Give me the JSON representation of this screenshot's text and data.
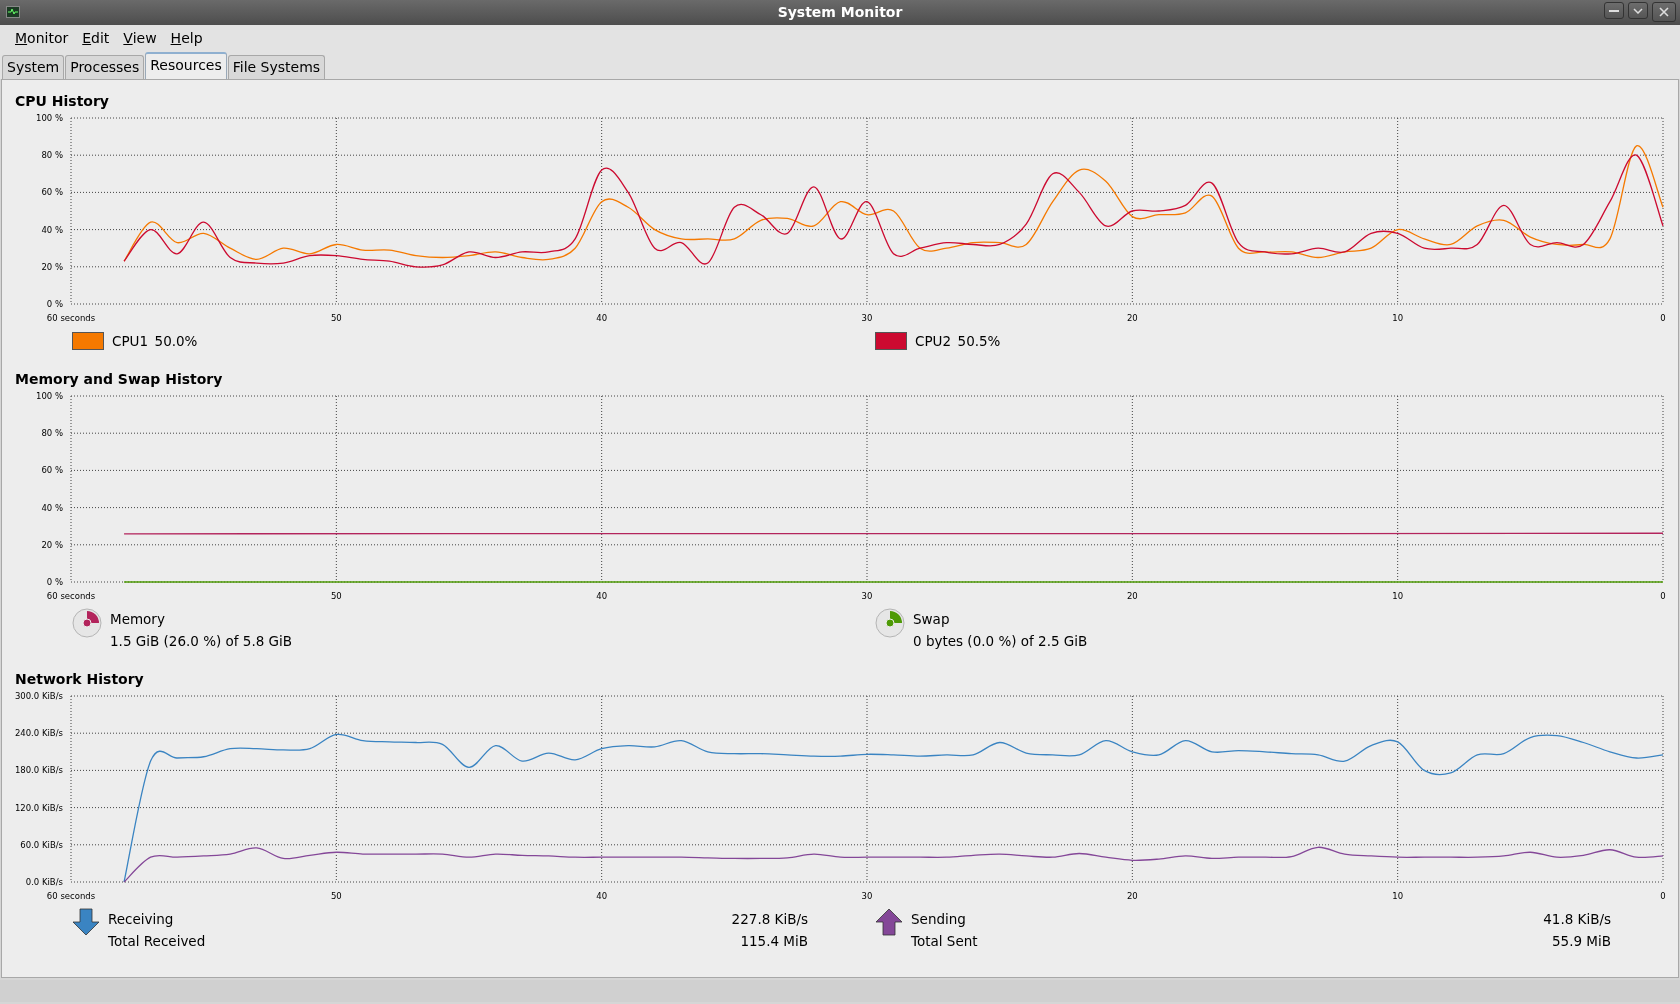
{
  "window": {
    "title": "System Monitor"
  },
  "menu": [
    {
      "label": "Monitor"
    },
    {
      "label": "Edit"
    },
    {
      "label": "View"
    },
    {
      "label": "Help"
    }
  ],
  "tabs": [
    {
      "label": "System",
      "selected": false
    },
    {
      "label": "Processes",
      "selected": false
    },
    {
      "label": "Resources",
      "selected": true
    },
    {
      "label": "File Systems",
      "selected": false
    }
  ],
  "sections": [
    {
      "kind": "cpu",
      "title": "CPU History",
      "chart_data": {
        "type": "line",
        "grid": true,
        "x": [
          58,
          57,
          56,
          55,
          54,
          53,
          52,
          51,
          50,
          49,
          48,
          47,
          46,
          45,
          44,
          43,
          42,
          41,
          40,
          39,
          38,
          37,
          36,
          35,
          34,
          33,
          32,
          31,
          30,
          29,
          28,
          27,
          26,
          25,
          24,
          23,
          22,
          21,
          20,
          19,
          18,
          17,
          16,
          15,
          14,
          13,
          12,
          11,
          10,
          9,
          8,
          7,
          6,
          5,
          4,
          3,
          2,
          1,
          0
        ],
        "xlim": [
          60,
          0
        ],
        "ylim": [
          0,
          100
        ],
        "xticks": [
          {
            "value": 60,
            "label": "60 seconds"
          },
          {
            "value": 50,
            "label": "50"
          },
          {
            "value": 40,
            "label": "40"
          },
          {
            "value": 30,
            "label": "30"
          },
          {
            "value": 20,
            "label": "20"
          },
          {
            "value": 10,
            "label": "10"
          },
          {
            "value": 0,
            "label": "0"
          }
        ],
        "yticks": [
          {
            "value": 0,
            "label": "0 %"
          },
          {
            "value": 20,
            "label": "20 %"
          },
          {
            "value": 40,
            "label": "40 %"
          },
          {
            "value": 60,
            "label": "60 %"
          },
          {
            "value": 80,
            "label": "80 %"
          },
          {
            "value": 100,
            "label": "100 %"
          }
        ],
        "series": [
          {
            "name": "CPU1",
            "color": "#f57900",
            "values": [
              23,
              44,
              33,
              38,
              30,
              24,
              30,
              27,
              32,
              29,
              29,
              26,
              25,
              26,
              28,
              25,
              24,
              30,
              55,
              52,
              40,
              35,
              35,
              35,
              45,
              46,
              42,
              55,
              48,
              50,
              30,
              30,
              33,
              33,
              32,
              55,
              72,
              66,
              47,
              48,
              49,
              58,
              30,
              28,
              28,
              25,
              28,
              30,
              40,
              35,
              32,
              42,
              45,
              36,
              32,
              32,
              35,
              85,
              52
            ]
          },
          {
            "name": "CPU2",
            "color": "#cc0a30",
            "values": [
              23,
              40,
              27,
              44,
              25,
              22,
              22,
              26,
              26,
              24,
              23,
              20,
              21,
              28,
              25,
              28,
              28,
              35,
              72,
              60,
              30,
              33,
              22,
              52,
              48,
              38,
              63,
              35,
              55,
              27,
              30,
              33,
              32,
              32,
              43,
              70,
              60,
              42,
              50,
              50,
              53,
              65,
              33,
              28,
              27,
              30,
              28,
              38,
              38,
              30,
              30,
              32,
              53,
              32,
              33,
              32,
              55,
              80,
              42
            ]
          }
        ]
      },
      "legend": [
        {
          "value": "50.0%"
        },
        {
          "value": "50.5%"
        }
      ]
    },
    {
      "kind": "memory",
      "title": "Memory and Swap History",
      "chart_data": {
        "type": "line",
        "grid": true,
        "x": [
          58,
          40,
          20,
          0
        ],
        "xlim": [
          60,
          0
        ],
        "ylim": [
          0,
          100
        ],
        "xticks": [
          {
            "value": 60,
            "label": "60 seconds"
          },
          {
            "value": 50,
            "label": "50"
          },
          {
            "value": 40,
            "label": "40"
          },
          {
            "value": 30,
            "label": "30"
          },
          {
            "value": 20,
            "label": "20"
          },
          {
            "value": 10,
            "label": "10"
          },
          {
            "value": 0,
            "label": "0"
          }
        ],
        "yticks": [
          {
            "value": 0,
            "label": "0 %"
          },
          {
            "value": 20,
            "label": "20 %"
          },
          {
            "value": 40,
            "label": "40 %"
          },
          {
            "value": 60,
            "label": "60 %"
          },
          {
            "value": 80,
            "label": "80 %"
          },
          {
            "value": 100,
            "label": "100 %"
          }
        ],
        "series": [
          {
            "name": "Memory",
            "color": "#b3245c",
            "values": [
              25.9,
              26,
              26,
              26.2
            ]
          },
          {
            "name": "Swap",
            "color": "#4e9a06",
            "values": [
              0,
              0,
              0,
              0
            ]
          }
        ]
      },
      "legend": [
        {
          "value": "1.5 GiB (26.0 %) of 5.8 GiB"
        },
        {
          "value": "0 bytes (0.0 %) of 2.5 GiB"
        }
      ]
    },
    {
      "kind": "network",
      "title": "Network History",
      "chart_data": {
        "type": "line",
        "grid": true,
        "x": [
          58,
          57,
          56,
          55,
          54,
          53,
          52,
          51,
          50,
          49,
          48,
          47,
          46,
          45,
          44,
          43,
          42,
          41,
          40,
          39,
          38,
          37,
          36,
          35,
          34,
          33,
          32,
          31,
          30,
          29,
          28,
          27,
          26,
          25,
          24,
          23,
          22,
          21,
          20,
          19,
          18,
          17,
          16,
          15,
          14,
          13,
          12,
          11,
          10,
          9,
          8,
          7,
          6,
          5,
          4,
          3,
          2,
          1,
          0
        ],
        "xlim": [
          60,
          0
        ],
        "ylim": [
          0,
          300
        ],
        "xticks": [
          {
            "value": 60,
            "label": "60 seconds"
          },
          {
            "value": 50,
            "label": "50"
          },
          {
            "value": 40,
            "label": "40"
          },
          {
            "value": 30,
            "label": "30"
          },
          {
            "value": 20,
            "label": "20"
          },
          {
            "value": 10,
            "label": "10"
          },
          {
            "value": 0,
            "label": "0"
          }
        ],
        "yticks": [
          {
            "value": 0,
            "label": "0.0 KiB/s"
          },
          {
            "value": 60,
            "label": "60.0 KiB/s"
          },
          {
            "value": 120,
            "label": "120.0 KiB/s"
          },
          {
            "value": 180,
            "label": "180.0 KiB/s"
          },
          {
            "value": 240,
            "label": "240.0 KiB/s"
          },
          {
            "value": 300,
            "label": "300.0 KiB/s"
          }
        ],
        "series": [
          {
            "name": "Receiving",
            "color": "#3a84c2",
            "values": [
              0,
              195,
              200,
              202,
              215,
              215,
              213,
              215,
              238,
              228,
              226,
              225,
              222,
              185,
              220,
              195,
              208,
              197,
              215,
              220,
              218,
              228,
              210,
              207,
              207,
              205,
              203,
              203,
              206,
              205,
              203,
              205,
              205,
              225,
              208,
              205,
              205,
              228,
              210,
              205,
              228,
              210,
              212,
              210,
              207,
              205,
              195,
              220,
              226,
              180,
              176,
              205,
              207,
              233,
              236,
              225,
              210,
              200,
              205
            ]
          },
          {
            "name": "Sending",
            "color": "#844798",
            "values": [
              0,
              40,
              40,
              42,
              45,
              55,
              38,
              43,
              48,
              45,
              45,
              45,
              45,
              40,
              45,
              43,
              42,
              40,
              40,
              40,
              40,
              40,
              39,
              38,
              38,
              39,
              45,
              40,
              40,
              40,
              40,
              40,
              43,
              45,
              42,
              40,
              46,
              40,
              35,
              37,
              42,
              38,
              40,
              40,
              41,
              56,
              45,
              42,
              40,
              40,
              40,
              40,
              42,
              48,
              40,
              43,
              52,
              40,
              42
            ]
          }
        ]
      },
      "legend": [
        {
          "value": "227.8 KiB/s",
          "total_label": "Total Received",
          "total": "115.4 MiB"
        },
        {
          "value": "41.8 KiB/s",
          "total_label": "Total Sent",
          "total": "55.9 MiB"
        }
      ]
    }
  ]
}
